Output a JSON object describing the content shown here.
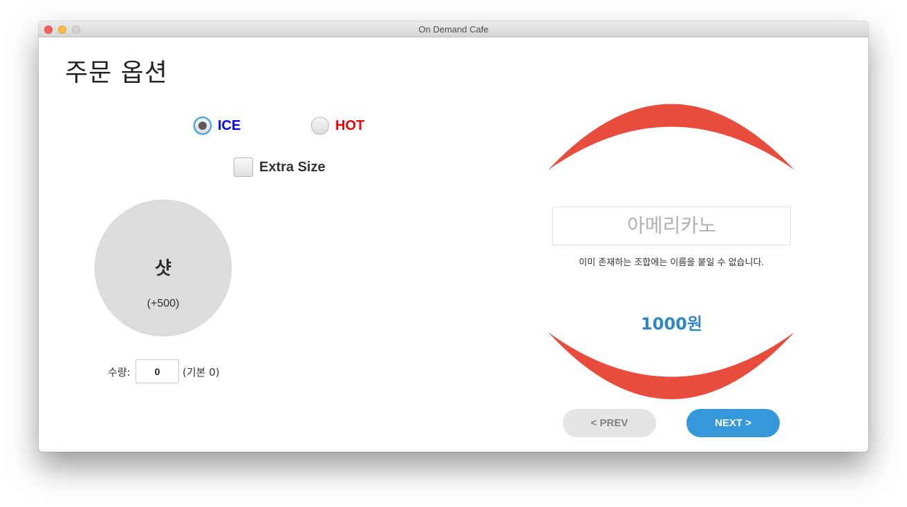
{
  "window": {
    "title": "On Demand Cafe"
  },
  "page": {
    "title": "주문 옵션"
  },
  "temperature": {
    "options": [
      {
        "label": "ICE",
        "color": "#0000ee",
        "selected": true
      },
      {
        "label": "HOT",
        "color": "#ee0000",
        "selected": false
      }
    ]
  },
  "extra_size": {
    "label": "Extra Size",
    "checked": false
  },
  "shot": {
    "name": "샷",
    "price": "(+500)"
  },
  "quantity": {
    "label": "수량:",
    "value": "0",
    "default_text": "(기본 0)"
  },
  "order": {
    "name_placeholder": "아메리카노",
    "name_hint": "이미 존재하는 조합에는 이름을 붙일 수 없습니다.",
    "price": "1000원",
    "accent_color": "#e74c3c",
    "price_color": "#2e86c8"
  },
  "navigation": {
    "prev_label": "< PREV",
    "next_label": "NEXT >",
    "next_color": "#3498db"
  }
}
